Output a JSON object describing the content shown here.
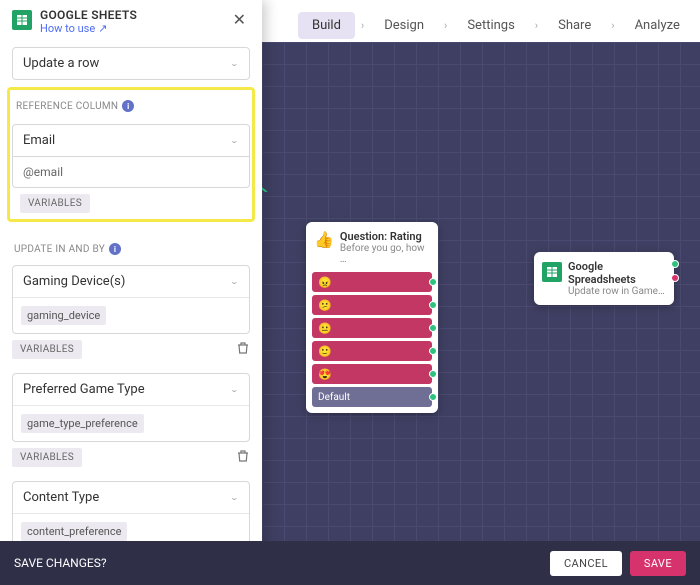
{
  "integration": {
    "title": "GOOGLE SHEETS",
    "howto": "How to use",
    "action": "Update a row"
  },
  "refcol": {
    "label": "REFERENCE COLUMN",
    "column": "Email",
    "value": "@email",
    "varbtn": "VARIABLES"
  },
  "update": {
    "label": "UPDATE IN AND BY",
    "fields": [
      {
        "col": "Gaming Device(s)",
        "var": "gaming_device"
      },
      {
        "col": "Preferred Game Type",
        "var": "game_type_preference"
      },
      {
        "col": "Content Type",
        "var": "content_preference"
      }
    ],
    "varbtn": "VARIABLES"
  },
  "savebar": {
    "prompt": "SAVE CHANGES?",
    "cancel": "CANCEL",
    "save": "SAVE"
  },
  "tabs": [
    "Build",
    "Design",
    "Settings",
    "Share",
    "Analyze"
  ],
  "canvas": {
    "question": {
      "title": "Question: Rating",
      "subtitle": "Before you go, how …",
      "emojis": [
        "😠",
        "😕",
        "😐",
        "🙂",
        "😍"
      ],
      "default": "Default"
    },
    "gsheets": {
      "title": "Google Spreadsheets",
      "subtitle": "Update row in Game…"
    }
  }
}
